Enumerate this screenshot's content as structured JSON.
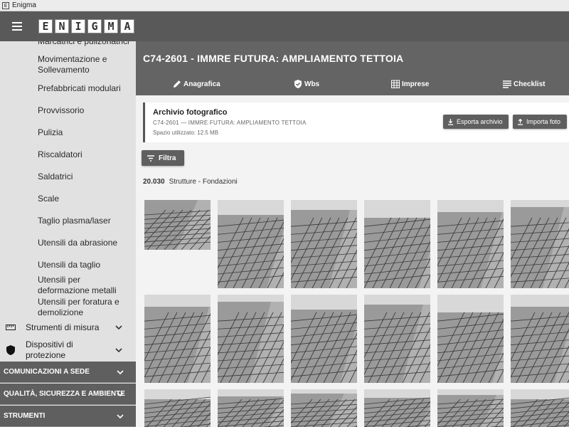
{
  "window": {
    "title": "Enigma",
    "icon_letter": "E"
  },
  "logo": {
    "letters": [
      "E",
      "N",
      "I",
      "G",
      "M",
      "A"
    ]
  },
  "sidebar": {
    "items": [
      {
        "label": "Marcatrici e pulizonatrici"
      },
      {
        "label": "Movimentazione e Sollevamento"
      },
      {
        "label": "Prefabbricati modulari"
      },
      {
        "label": "Provvissorio"
      },
      {
        "label": "Pulizia"
      },
      {
        "label": "Riscaldatori"
      },
      {
        "label": "Saldatrici"
      },
      {
        "label": "Scale"
      },
      {
        "label": "Taglio plasma/laser"
      },
      {
        "label": "Utensili da abrasione"
      },
      {
        "label": "Utensili da taglio"
      },
      {
        "label": "Utensili per deformazione metalli"
      },
      {
        "label": "Utensili per foratura e demolizione"
      }
    ],
    "groups": [
      {
        "label": "Strumenti di misura",
        "icon": "ruler-icon"
      },
      {
        "label": "Dispositivi di protezione",
        "icon": "shield-icon"
      }
    ],
    "sections": [
      {
        "label": "COMUNICAZIONI A SEDE"
      },
      {
        "label": "QUALITÀ, SICUREZZA E AMBIENTE"
      },
      {
        "label": "STRUMENTI"
      }
    ]
  },
  "header": {
    "title": "C74-2601 - IMMRE FUTURA: AMPLIAMENTO TETTOIA",
    "tabs": [
      {
        "label": "Anagrafica",
        "icon": "pencil-icon"
      },
      {
        "label": "Wbs",
        "icon": "shield-check-icon"
      },
      {
        "label": "Imprese",
        "icon": "building-icon"
      },
      {
        "label": "Checklist",
        "icon": "list-icon"
      }
    ]
  },
  "archive": {
    "title": "Archivio fotografico",
    "subtitle": "C74-2601 — IMMRE FUTURA: AMPLIAMENTO TETTOIA",
    "space": "Spazio utilizzato: 12.5 MB",
    "export_label": "Esporta archivio",
    "import_label": "Importa foto"
  },
  "filter": {
    "label": "Filtra"
  },
  "breadcrumb": {
    "code": "20.030",
    "label": "Strutture - Fondazioni"
  },
  "photos": {
    "count": 18,
    "description_row1": "rebar foundation photos",
    "colors": {
      "sky": "#d8d8d8",
      "ground": "#9a9a9a",
      "rebar": "#3a3a3a",
      "concrete": "#c4c4c4"
    }
  }
}
